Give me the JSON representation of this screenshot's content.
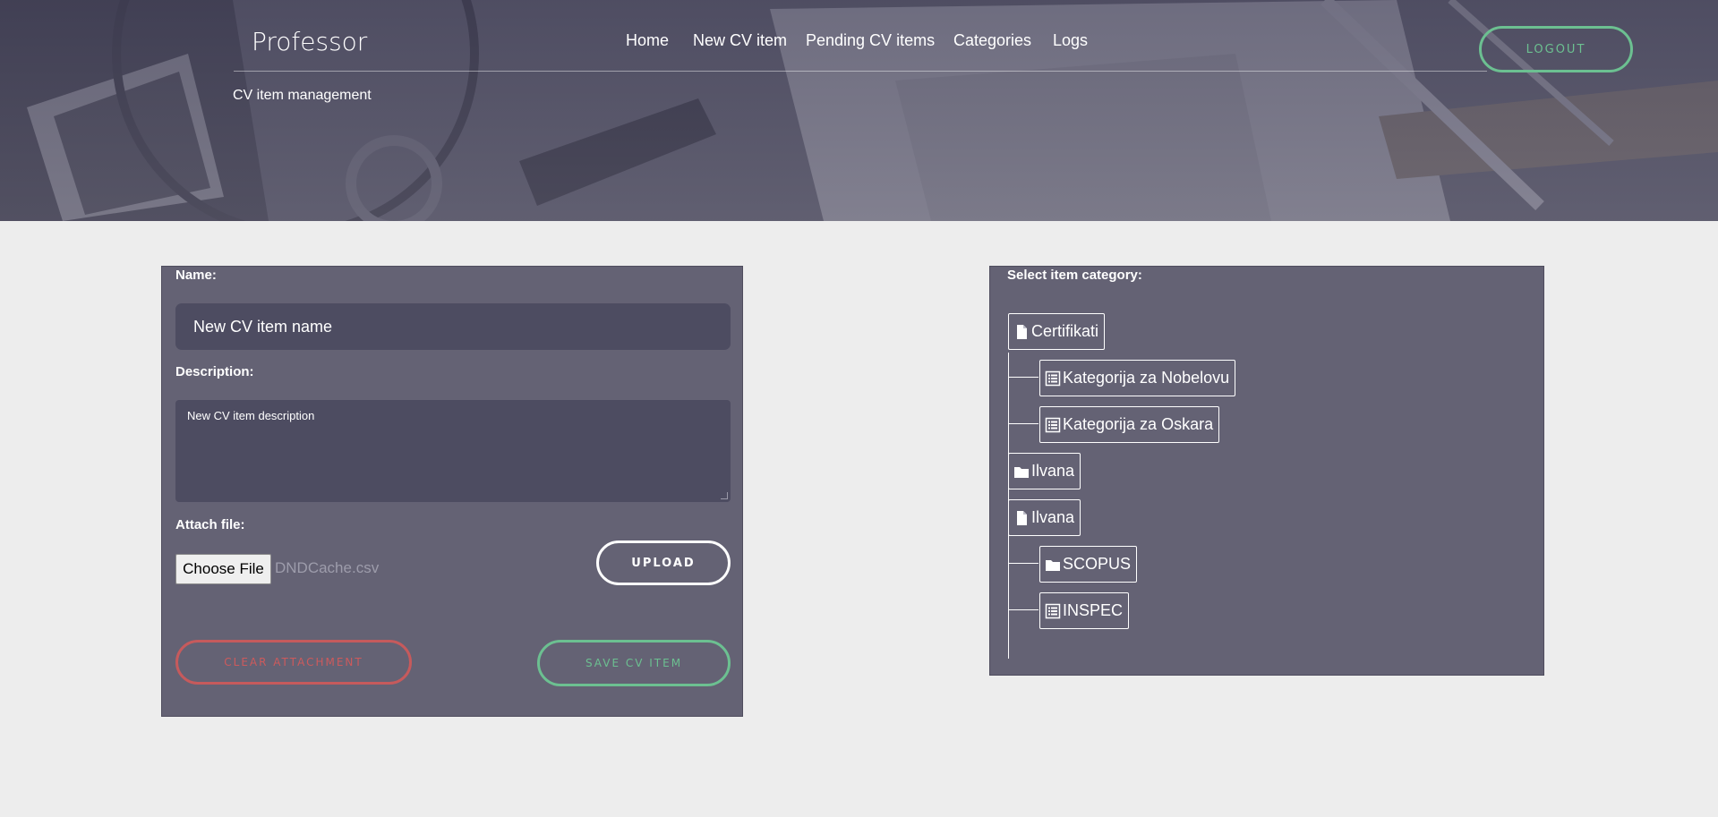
{
  "header": {
    "brand": "Professor",
    "subtitle": "CV item management",
    "nav": [
      {
        "label": "Home"
      },
      {
        "label": "New CV item"
      },
      {
        "label": "Pending CV items"
      },
      {
        "label": "Categories"
      },
      {
        "label": "Logs"
      }
    ],
    "logout_label": "LOGOUT"
  },
  "form": {
    "name_label": "Name:",
    "name_value": "New CV item name",
    "description_label": "Description:",
    "description_value": "New CV item description",
    "attach_label": "Attach file:",
    "choose_file_label": "Choose File",
    "file_name": "DNDCache.csv",
    "upload_label": "UPLOAD",
    "clear_label": "CLEAR ATTACHMENT",
    "save_label": "SAVE CV ITEM"
  },
  "categories": {
    "title": "Select item category:",
    "tree": [
      {
        "label": "Certifikati",
        "icon": "file-icon"
      },
      {
        "label": "Kategorija za Nobelovu",
        "icon": "list-icon"
      },
      {
        "label": "Kategorija za Oskara",
        "icon": "list-icon"
      },
      {
        "label": " Ilvana",
        "icon": "folder-icon"
      },
      {
        "label": "Ilvana",
        "icon": "file-icon"
      },
      {
        "label": " SCOPUS",
        "icon": "folder-icon"
      },
      {
        "label": "INSPEC",
        "icon": "list-icon"
      }
    ]
  },
  "colors": {
    "accent_green": "#6cc091",
    "accent_red": "#c65a5c",
    "panel_bg": "#646274",
    "input_bg": "#4d4c61",
    "page_bg": "#ededed"
  }
}
